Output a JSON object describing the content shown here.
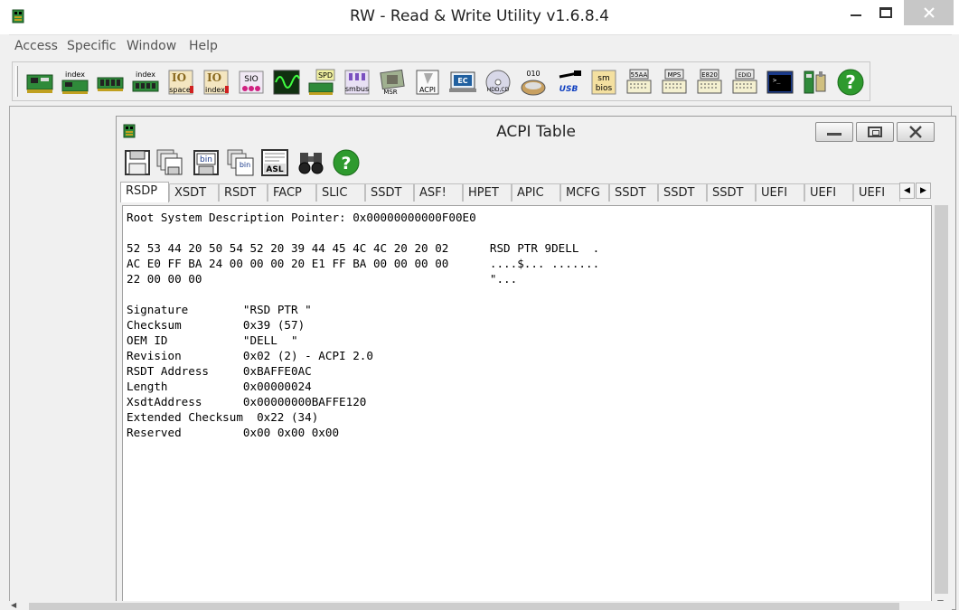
{
  "window": {
    "title": "RW - Read & Write Utility v1.6.8.4"
  },
  "menu": {
    "items": [
      "Access",
      "Specific",
      "Window",
      "Help"
    ]
  },
  "toolbar": {
    "icons": [
      {
        "name": "pci-icon",
        "label": ""
      },
      {
        "name": "pci-index-icon",
        "label": "index"
      },
      {
        "name": "memory-icon",
        "label": ""
      },
      {
        "name": "memory-index-icon",
        "label": "index"
      },
      {
        "name": "io-space-icon",
        "label": "space"
      },
      {
        "name": "io-index-icon",
        "label": "index"
      },
      {
        "name": "sio-icon",
        "label": "SIO"
      },
      {
        "name": "oscilloscope-icon",
        "label": ""
      },
      {
        "name": "spd-icon",
        "label": "SPD"
      },
      {
        "name": "smbus-icon",
        "label": "smbus"
      },
      {
        "name": "msr-icon",
        "label": "MSR"
      },
      {
        "name": "acpi-icon",
        "label": "ACPI"
      },
      {
        "name": "ec-icon",
        "label": "EC"
      },
      {
        "name": "hdd-cd-icon",
        "label": "HDD,CD"
      },
      {
        "name": "disk-010-icon",
        "label": "010"
      },
      {
        "name": "usb-icon",
        "label": "USB"
      },
      {
        "name": "smbios-icon",
        "label": "sm bios"
      },
      {
        "name": "55aa-icon",
        "label": "55AA"
      },
      {
        "name": "mps-icon",
        "label": "MPS"
      },
      {
        "name": "e820-icon",
        "label": "E820"
      },
      {
        "name": "edid-icon",
        "label": "EDID"
      },
      {
        "name": "command-prompt-icon",
        "label": ""
      },
      {
        "name": "settings-icon",
        "label": ""
      },
      {
        "name": "help-icon",
        "label": "?"
      }
    ]
  },
  "acpi_window": {
    "title": "ACPI Table",
    "toolbar": [
      {
        "name": "save-icon",
        "label": ""
      },
      {
        "name": "save-all-icon",
        "label": ""
      },
      {
        "name": "save-bin-icon",
        "label": "bin"
      },
      {
        "name": "save-all-bin-icon",
        "label": "bin"
      },
      {
        "name": "asl-icon",
        "label": "ASL"
      },
      {
        "name": "find-icon",
        "label": ""
      },
      {
        "name": "help-icon",
        "label": "?"
      }
    ],
    "tabs": [
      "RSDP",
      "XSDT",
      "RSDT",
      "FACP",
      "SLIC",
      "SSDT",
      "ASF!",
      "HPET",
      "APIC",
      "MCFG",
      "SSDT",
      "SSDT",
      "SSDT",
      "UEFI",
      "UEFI",
      "UEFI"
    ],
    "active_tab": "RSDP",
    "content": {
      "header": "Root System Description Pointer: 0x00000000000F00E0",
      "hex_lines": [
        {
          "hex": "52 53 44 20 50 54 52 20 39 44 45 4C 4C 20 20 02",
          "ascii": "RSD PTR 9DELL  ."
        },
        {
          "hex": "AC E0 FF BA 24 00 00 00 20 E1 FF BA 00 00 00 00",
          "ascii": "....$... ......."
        },
        {
          "hex": "22 00 00 00",
          "ascii": "\"..."
        }
      ],
      "fields": [
        {
          "label": "Signature",
          "value": "\"RSD PTR \""
        },
        {
          "label": "Checksum",
          "value": "0x39 (57)"
        },
        {
          "label": "OEM ID",
          "value": "\"DELL  \""
        },
        {
          "label": "Revision",
          "value": "0x02 (2) - ACPI 2.0"
        },
        {
          "label": "RSDT Address",
          "value": "0xBAFFE0AC"
        },
        {
          "label": "Length",
          "value": "0x00000024"
        },
        {
          "label": "XsdtAddress",
          "value": "0x00000000BAFFE120"
        },
        {
          "label": "Extended Checksum",
          "value": "0x22 (34)"
        },
        {
          "label": "Reserved",
          "value": "0x00 0x00 0x00"
        }
      ]
    }
  },
  "colors": {
    "titlebar": "#ffffff",
    "window_bg": "#f0f0f0",
    "help_green": "#2e9a2e",
    "chip_green": "#2f8a3a"
  }
}
